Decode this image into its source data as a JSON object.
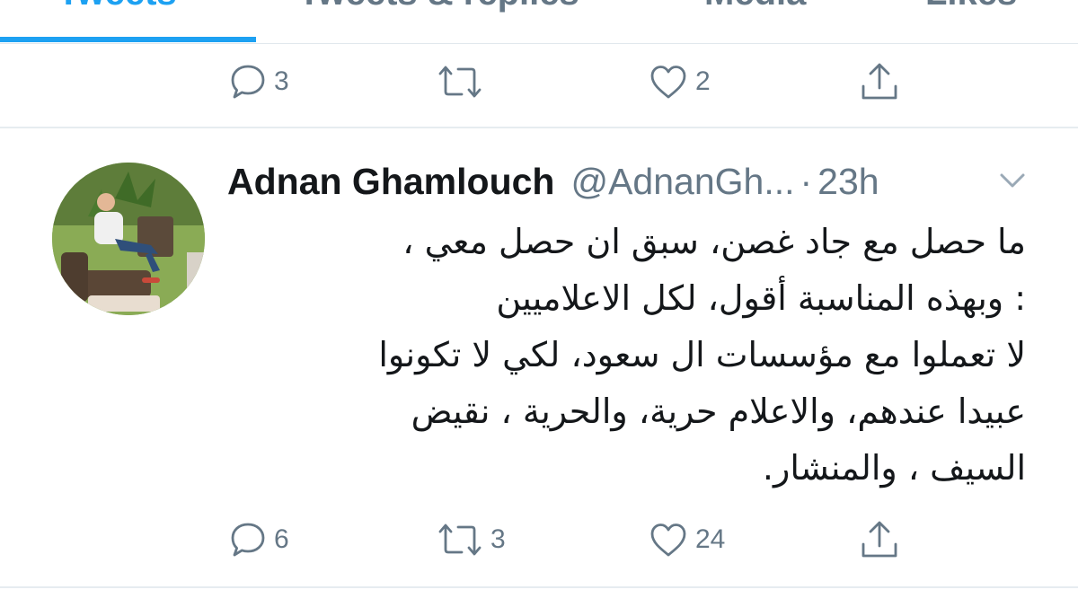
{
  "tabs": [
    {
      "label": "Tweets",
      "active": true
    },
    {
      "label": "Tweets & replies",
      "active": false
    },
    {
      "label": "Media",
      "active": false
    },
    {
      "label": "Likes",
      "active": false
    }
  ],
  "previous_tweet": {
    "reply_count": "3",
    "retweet_count": "",
    "like_count": "2"
  },
  "tweet": {
    "author_name": "Adnan Ghamlouch",
    "author_handle": "@AdnanGh...",
    "separator": "·",
    "time": "23h",
    "lines": [
      "ما حصل مع جاد غصن، سبق ان حصل معي ،",
      ": وبهذه المناسبة أقول، لكل الاعلاميين",
      "لا تعملوا مع مؤسسات ال سعود، لكي لا تكونوا",
      "عبيدا عندهم، والاعلام حرية، والحرية   ، نقيض",
      "السيف ، والمنشار."
    ],
    "reply_count": "6",
    "retweet_count": "3",
    "like_count": "24"
  },
  "colors": {
    "accent": "#1da1f2",
    "secondary_text": "#657786",
    "divider": "#e6ecf0"
  },
  "icons": [
    "reply-icon",
    "retweet-icon",
    "like-icon",
    "share-icon",
    "chevron-down-icon"
  ]
}
